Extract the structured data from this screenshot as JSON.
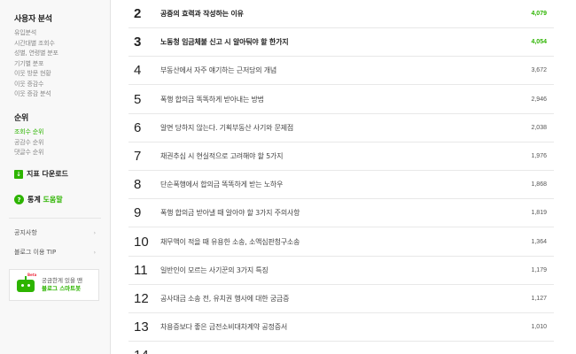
{
  "sidebar": {
    "user_analysis": {
      "title": "사용자 분석",
      "items": [
        "유입분석",
        "시간대별 조회수",
        "성별, 연령별 분포",
        "기기별 분포",
        "이웃 방문 현황",
        "이웃 증감수",
        "이웃 증감 분석"
      ]
    },
    "ranking": {
      "title": "순위",
      "items": [
        "조회수 순위",
        "공감수 순위",
        "댓글수 순위"
      ],
      "active_index": 0
    },
    "download": {
      "icon_char": "↓",
      "label": "지표 다운로드"
    },
    "help": {
      "icon_char": "?",
      "label_bold": "통계",
      "label_green": "도움말"
    },
    "menus": [
      "공지사항",
      "블로그 이용 TIP"
    ],
    "menu_arrow": "›",
    "bot": {
      "badge": "Beta",
      "line1": "궁금한게 있을 땐",
      "line2": "블로그 스마트봇"
    }
  },
  "ranking_list": [
    {
      "rank": "2",
      "title": "공증의 효력과 작성하는 이유",
      "count": "4,079",
      "highlight": true
    },
    {
      "rank": "3",
      "title": "노동청 임금체불 신고 시 알아둬야 할 한가지",
      "count": "4,054",
      "highlight": true
    },
    {
      "rank": "4",
      "title": "부동산에서 자주 얘기하는 근저당의 개념",
      "count": "3,672",
      "highlight": false
    },
    {
      "rank": "5",
      "title": "폭행 합의금 똑똑하게 받아내는 방법",
      "count": "2,946",
      "highlight": false
    },
    {
      "rank": "6",
      "title": "알면 당하지 않는다. 기획부동산 사기와 문제점",
      "count": "2,038",
      "highlight": false
    },
    {
      "rank": "7",
      "title": "채권추심 시 현실적으로 고려해야 할 5가지",
      "count": "1,976",
      "highlight": false
    },
    {
      "rank": "8",
      "title": "단순폭행에서 합의금 똑똑하게 받는 노하우",
      "count": "1,868",
      "highlight": false
    },
    {
      "rank": "9",
      "title": "폭행 합의금 받아낼 때 알아야 할 3가지 주의사항",
      "count": "1,819",
      "highlight": false
    },
    {
      "rank": "10",
      "title": "채무액이 적을 때 유용한 소송, 소액심판청구소송",
      "count": "1,364",
      "highlight": false
    },
    {
      "rank": "11",
      "title": "일반인이 모르는 사기꾼의 3가지 특징",
      "count": "1,179",
      "highlight": false
    },
    {
      "rank": "12",
      "title": "공사대금 소송 전, 유치권 행사에 대한 궁금증",
      "count": "1,127",
      "highlight": false
    },
    {
      "rank": "13",
      "title": "차용증보다 좋은 금전소비대차계약 공정증서",
      "count": "1,010",
      "highlight": false
    },
    {
      "rank": "14",
      "title": "",
      "count": "",
      "highlight": false
    }
  ],
  "colors": {
    "accent": "#2db400",
    "sidebar_bg": "#f8f8f8"
  }
}
